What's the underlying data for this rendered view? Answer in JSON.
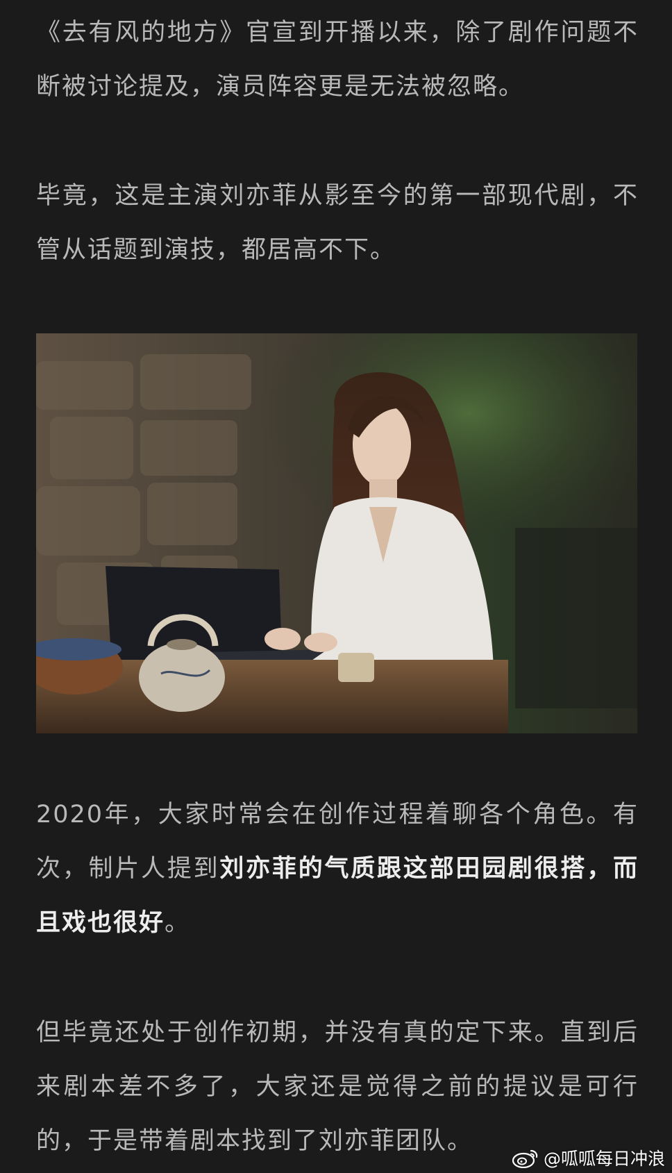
{
  "article": {
    "p1": "《去有风的地方》官宣到开播以来，除了剧作问题不断被讨论提及，演员阵容更是无法被忽略。",
    "p2": "毕竟，这是主演刘亦菲从影至今的第一部现代剧，不管从话题到演技，都居高不下。",
    "p3_start": "2020年，大家时常会在创作过程着聊各个角色。有次，制片人提到",
    "p3_bold": "刘亦菲的气质跟这部田园剧很搭，而且戏也很好",
    "p3_end": "。",
    "p4": "但毕竟还处于创作初期，并没有真的定下来。直到后来剧本差不多了，大家还是觉得之前的提议是可行的，于是带着剧本找到了刘亦菲团队。"
  },
  "watermark": {
    "text": "@呱呱每日冲浪",
    "icon": "weibo-icon"
  },
  "colors": {
    "background": "#1b1b1b",
    "text": "#b9b9b9",
    "bold_text": "#ededed"
  }
}
